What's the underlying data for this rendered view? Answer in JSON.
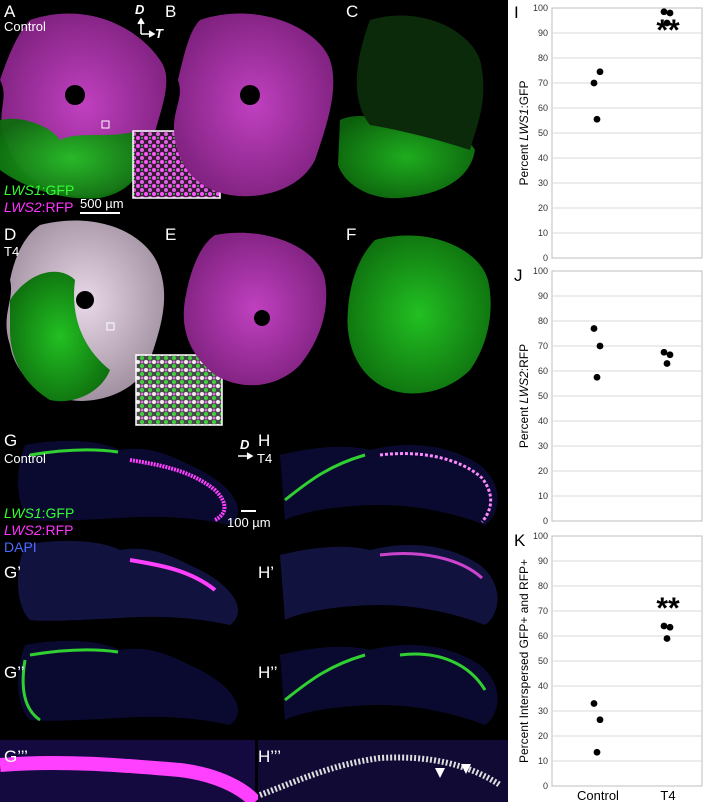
{
  "panels": {
    "A": "A",
    "B": "B",
    "C": "C",
    "D": "D",
    "E": "E",
    "F": "F",
    "G": "G",
    "H": "H",
    "G1": "G’",
    "H1": "H’",
    "G2": "G’’",
    "H2": "H’’",
    "G3": "G’’’",
    "H3": "H’’’",
    "I": "I",
    "J": "J",
    "K": "K"
  },
  "conditions": {
    "control": "Control",
    "t4": "T4"
  },
  "axes_orientation": {
    "dorsal": "D",
    "temporal": "T"
  },
  "legend": {
    "gene1": "LWS1",
    "gene2": "LWS2",
    "gfp": ":GFP",
    "rfp": ":RFP",
    "dapi": "DAPI"
  },
  "scalebars": {
    "whole": "500 µm",
    "section": "100 µm"
  },
  "colors": {
    "gfp": "#33ff33",
    "rfp": "#ff33ff",
    "dapi": "#4a6bff"
  },
  "chart_data": [
    {
      "type": "scatter",
      "panel": "I",
      "ylabel_prefix": "Percent ",
      "ylabel_gene": "LWS1",
      "ylabel_suffix": ":GFP",
      "ylim": [
        0,
        100
      ],
      "yticks": [
        0,
        10,
        20,
        30,
        40,
        50,
        60,
        70,
        80,
        90,
        100
      ],
      "categories": [
        "Control",
        "T4"
      ],
      "points": [
        {
          "x": "Control",
          "y": 70
        },
        {
          "x": "Control",
          "y": 74.5
        },
        {
          "x": "Control",
          "y": 55.5
        },
        {
          "x": "T4",
          "y": 98.5
        },
        {
          "x": "T4",
          "y": 98
        },
        {
          "x": "T4",
          "y": 94
        }
      ],
      "annotation": "**",
      "grid": true
    },
    {
      "type": "scatter",
      "panel": "J",
      "ylabel_prefix": "Percent ",
      "ylabel_gene": "LWS2",
      "ylabel_suffix": ":RFP",
      "ylim": [
        0,
        100
      ],
      "yticks": [
        0,
        10,
        20,
        30,
        40,
        50,
        60,
        70,
        80,
        90,
        100
      ],
      "categories": [
        "Control",
        "T4"
      ],
      "points": [
        {
          "x": "Control",
          "y": 77
        },
        {
          "x": "Control",
          "y": 70
        },
        {
          "x": "Control",
          "y": 57.5
        },
        {
          "x": "T4",
          "y": 67.5
        },
        {
          "x": "T4",
          "y": 66.5
        },
        {
          "x": "T4",
          "y": 63
        }
      ],
      "annotation": "",
      "grid": true
    },
    {
      "type": "scatter",
      "panel": "K",
      "ylabel_prefix": "Percent Interspersed GFP+ and RFP+",
      "ylabel_gene": "",
      "ylabel_suffix": "",
      "ylim": [
        0,
        100
      ],
      "yticks": [
        0,
        10,
        20,
        30,
        40,
        50,
        60,
        70,
        80,
        90,
        100
      ],
      "categories": [
        "Control",
        "T4"
      ],
      "points": [
        {
          "x": "Control",
          "y": 33
        },
        {
          "x": "Control",
          "y": 26.5
        },
        {
          "x": "Control",
          "y": 13.5
        },
        {
          "x": "T4",
          "y": 64
        },
        {
          "x": "T4",
          "y": 63.5
        },
        {
          "x": "T4",
          "y": 59
        }
      ],
      "annotation": "**",
      "grid": true
    }
  ]
}
